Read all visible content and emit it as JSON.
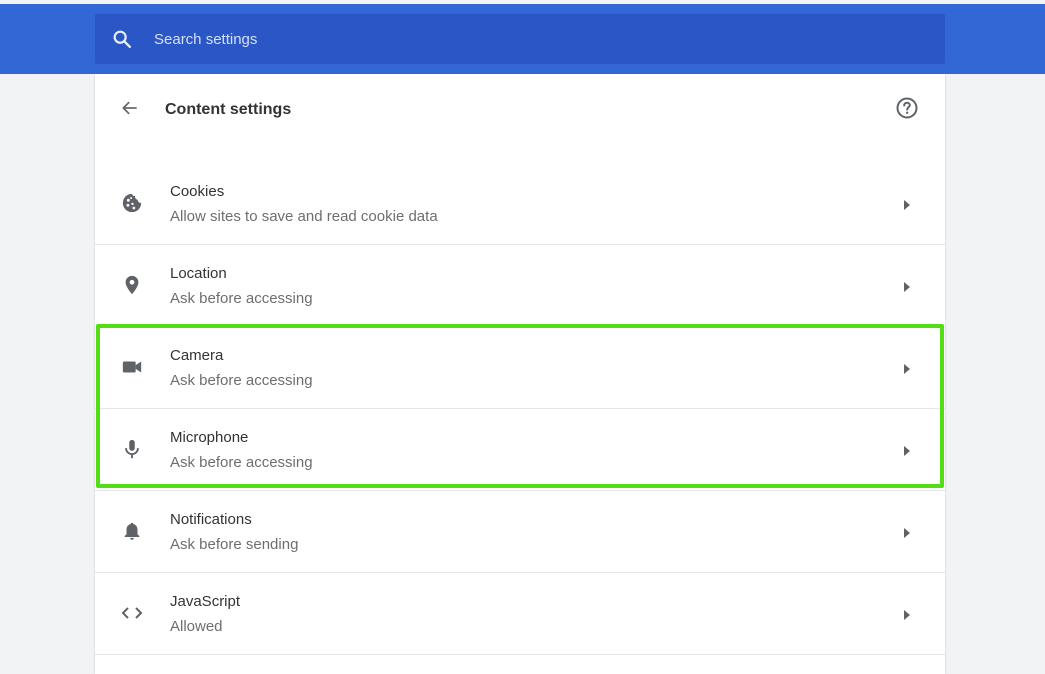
{
  "search": {
    "placeholder": "Search settings"
  },
  "header": {
    "title": "Content settings"
  },
  "items": [
    {
      "icon": "cookie-icon",
      "title": "Cookies",
      "subtitle": "Allow sites to save and read cookie data"
    },
    {
      "icon": "location-pin-icon",
      "title": "Location",
      "subtitle": "Ask before accessing"
    },
    {
      "icon": "camera-icon",
      "title": "Camera",
      "subtitle": "Ask before accessing"
    },
    {
      "icon": "microphone-icon",
      "title": "Microphone",
      "subtitle": "Ask before accessing"
    },
    {
      "icon": "bell-icon",
      "title": "Notifications",
      "subtitle": "Ask before sending"
    },
    {
      "icon": "code-icon",
      "title": "JavaScript",
      "subtitle": "Allowed"
    }
  ],
  "colors": {
    "header_blue": "#3367d6",
    "search_blue": "#2a56c6",
    "highlight_green": "#52dd15",
    "icon_gray": "#5f6368"
  }
}
